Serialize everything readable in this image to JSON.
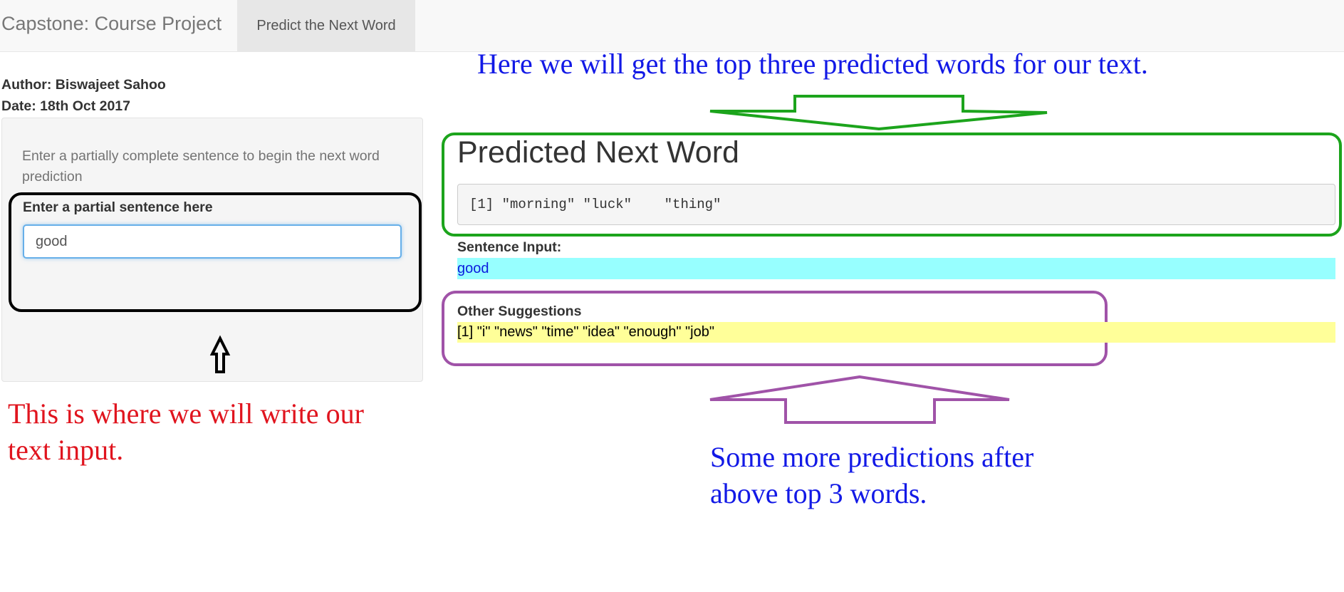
{
  "navbar": {
    "brand": "Capstone: Course Project",
    "tab_label": "Predict the Next Word"
  },
  "sidebar": {
    "author": "Author: Biswajeet Sahoo",
    "date": "Date: 18th Oct 2017",
    "help_text": "Enter a partially complete sentence to begin the next word prediction",
    "input_label": "Enter a partial sentence here",
    "input_value": "good "
  },
  "main": {
    "predicted_title": "Predicted Next Word",
    "predicted_output": "[1] \"morning\" \"luck\"    \"thing\"",
    "sentence_label": "Sentence Input:",
    "sentence_value": "good",
    "other_label": "Other Suggestions",
    "other_value": "[1] \"i\" \"news\" \"time\" \"idea\" \"enough\" \"job\""
  },
  "annotations": {
    "top_note": "Here we will get the top three predicted words for our text.",
    "left_note": "This is where we will write our text input.",
    "bottom_note": "Some more predictions after above top 3 words."
  },
  "colors": {
    "green": "#1ca41c",
    "purple": "#a053a8",
    "red": "#e0141e",
    "blue": "#1219e6",
    "cyan_highlight": "#97ffff",
    "yellow_highlight": "#ffff99"
  }
}
